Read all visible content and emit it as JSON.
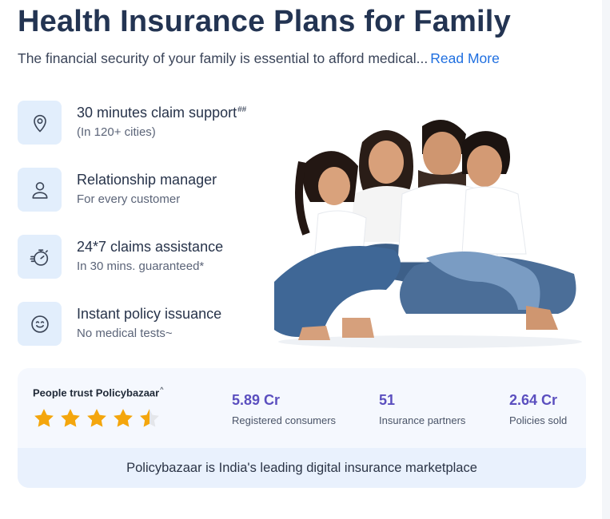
{
  "header": {
    "title": "Health Insurance Plans for Family",
    "subtitle": "The financial security of your family is essential to afford medical",
    "ellipsis": "...",
    "read_more": "Read More"
  },
  "features": [
    {
      "title": "30 minutes claim support",
      "sup": "##",
      "sub": "(In 120+ cities)",
      "icon": "location-pin-icon"
    },
    {
      "title": "Relationship manager",
      "sup": "",
      "sub": "For every customer",
      "icon": "person-icon"
    },
    {
      "title": "24*7 claims assistance",
      "sup": "",
      "sub": "In 30 mins. guaranteed*",
      "icon": "stopwatch-icon"
    },
    {
      "title": "Instant policy issuance",
      "sup": "",
      "sub": "No medical tests~",
      "icon": "smiley-icon"
    }
  ],
  "trust": {
    "label": "People trust Policybazaar",
    "label_sup": "^",
    "rating": 4.5,
    "rating_max": 5,
    "star_color": "#f4a60d",
    "stats": [
      {
        "value": "5.89 Cr",
        "label": "Registered consumers"
      },
      {
        "value": "51",
        "label": "Insurance partners"
      },
      {
        "value": "2.64 Cr",
        "label": "Policies sold"
      }
    ],
    "footer": "Policybazaar is India's leading digital insurance marketplace"
  },
  "colors": {
    "title": "#233452",
    "link": "#1f6fe0",
    "icon_bg": "#e2eefc",
    "stat_value": "#5b4fbf"
  }
}
